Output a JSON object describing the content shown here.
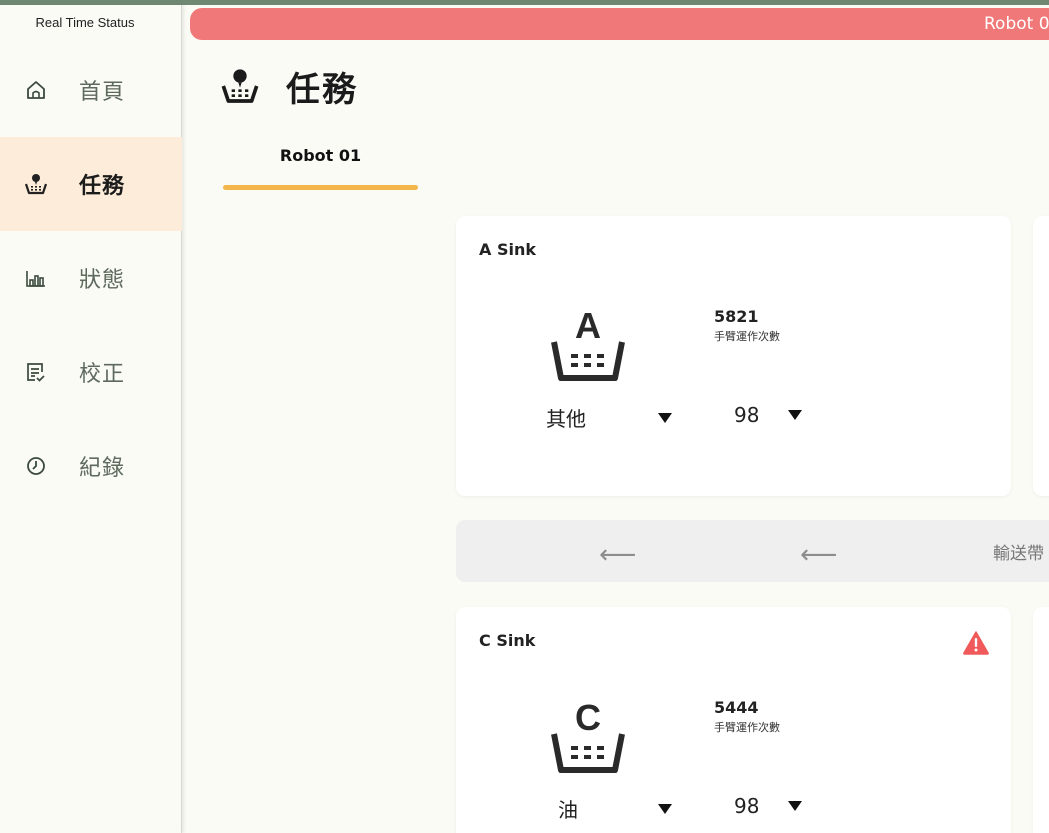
{
  "app": {
    "title": "Real Time Status"
  },
  "sidebar": {
    "items": [
      {
        "label": "首頁",
        "icon": "home-icon"
      },
      {
        "label": "任務",
        "icon": "task-basket-icon",
        "active": true
      },
      {
        "label": "狀態",
        "icon": "bar-chart-icon"
      },
      {
        "label": "校正",
        "icon": "checklist-icon"
      },
      {
        "label": "紀錄",
        "icon": "clock-icon"
      }
    ]
  },
  "banner": {
    "text": "Robot 0"
  },
  "header": {
    "title": "任務",
    "icon": "task-basket-icon"
  },
  "tabs": [
    {
      "label": "Robot 01",
      "active": true
    }
  ],
  "cards": [
    {
      "title": "A Sink",
      "letter": "A",
      "count": "5821",
      "count_label": "手臂運作次數",
      "category": "其他",
      "number": "98",
      "warning": false
    },
    {
      "title": "C Sink",
      "letter": "C",
      "count": "5444",
      "count_label": "手臂運作次數",
      "category": "油",
      "number": "98",
      "warning": true
    }
  ],
  "conveyor": {
    "label": "輸送帶",
    "arrows": [
      "⟵",
      "⟵"
    ]
  },
  "colors": {
    "accent": "#f3b64a",
    "active_bg": "#fdecd9",
    "banner": "#f07878",
    "warning": "#f05a5a",
    "background": "#f9fbf4"
  }
}
